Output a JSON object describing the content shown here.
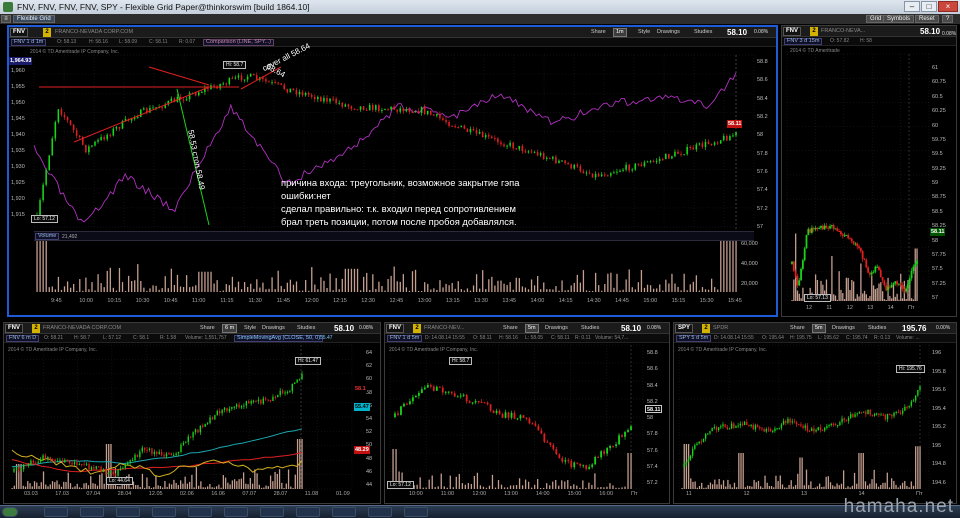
{
  "window": {
    "title": "FNV, FNV, FNV, FNV, SPY - Flexible Grid Paper@thinkorswim [build 1864.10]"
  },
  "menu": {
    "tab": "Flexible Grid",
    "grid": "Grid",
    "symbols": "Symbols",
    "reset": "Reset",
    "help": "?"
  },
  "common": {
    "company": "FRANCO-NEVADA CORP.COM",
    "share": "Share",
    "style": "Style",
    "drawings": "Drawings",
    "studies": "Studies",
    "badge": "2",
    "copyright": "2014 © TD Ameritrade IP Company, Inc."
  },
  "main": {
    "symbol": "FNV",
    "price": "58.10",
    "change": "0.08%",
    "info": {
      "chip": "FNV 1 d 1m",
      "o": "O: 58.13",
      "h": "H: 58.16",
      "l": "L: 58.09",
      "c": "C: 58.11",
      "r": "R: 0.07",
      "cmp": "Comparison (LINE, SPY...)"
    },
    "yticks": [
      "58.8",
      "58.6",
      "58.4",
      "58.2",
      "58",
      "57.8",
      "57.6",
      "57.4",
      "57.2",
      "57"
    ],
    "left_price": "1,964.93",
    "left_ticks": [
      "1,960",
      "1,955",
      "1,950",
      "1,945",
      "1,940",
      "1,935",
      "1,930",
      "1,925",
      "1,920",
      "1,915"
    ],
    "price_tag": "58.11",
    "hi": "Hi: 58.7",
    "lo": "Lo: 57.12",
    "vol_label": "Volume",
    "vol_value": "21,492",
    "vol_ticks": [
      "60,000",
      "40,000",
      "20,000"
    ],
    "xticks": [
      "9:45",
      "10:00",
      "10:15",
      "10:30",
      "10:45",
      "11:00",
      "11:15",
      "11:30",
      "11:45",
      "12:00",
      "12:15",
      "12:30",
      "12:45",
      "13:00",
      "13:15",
      "13:30",
      "13:45",
      "14:00",
      "14:15",
      "14:30",
      "14:45",
      "15:00",
      "15:15",
      "15:30",
      "15:45"
    ],
    "annotations": {
      "a1": "58.64",
      "a2": "cover all 58.64",
      "a3": "58.53 стоп 58.49"
    },
    "note": [
      "причина входа: треугольник, возможное закрытие гэпа",
      "ошибки:нет",
      "сделал правильно: т.к. входил перед сопротивлением",
      "брал треть позиции, потом после пробоя добавлялся."
    ]
  },
  "topright": {
    "symbol": "FNV",
    "price": "58.10",
    "change": "0.08%",
    "chip": "FNV 3 d 15m",
    "o": "O: 57.82",
    "h": "H: 58",
    "yticks": [
      "61",
      "60.75",
      "60.5",
      "60.25",
      "60",
      "59.75",
      "59.5",
      "59.25",
      "59",
      "58.75",
      "58.5",
      "58.25",
      "58",
      "57.75",
      "57.5",
      "57.25",
      "57"
    ],
    "price_tag": "58.11",
    "lo": "Lo: 57.13",
    "xticks": [
      "12",
      "11",
      "12",
      "13",
      "14",
      "Пт"
    ]
  },
  "bl": {
    "symbol": "FNV",
    "price": "58.10",
    "change": "0.08%",
    "info": {
      "chip": "FNV 6 m D",
      "o": "O: 58.21",
      "h": "H: 58.7",
      "l": "L: 57.12",
      "c": "C: 58.1",
      "r": "R: 1.58",
      "vol": "Volume: 1,551,757",
      "sma": "SimpleMovingAvg (CLOSE, 50, 0)",
      "sma_val": "55.47"
    },
    "yticks": [
      "64",
      "62",
      "60",
      "58",
      "56",
      "54",
      "52",
      "50",
      "48",
      "46",
      "44"
    ],
    "tags": {
      "price": "58.1",
      "sma": "55.47",
      "other": "48.29"
    },
    "hi": "Hi: 61.47",
    "lo": "Lo: 44.64",
    "xticks": [
      "03.03",
      "17.03",
      "07.04",
      "28.04",
      "12.05",
      "02.06",
      "16.06",
      "07.07",
      "28.07",
      "11.08",
      "01.09"
    ]
  },
  "bm": {
    "symbol": "FNV",
    "price": "58.10",
    "change": "0.08%",
    "info": {
      "chip": "FNV 1 d 5m",
      "d": "D: 14.08.14 15:55",
      "o": "O: 58.11",
      "h": "H: 58.16",
      "l": "L: 58.05",
      "c": "C: 58.11",
      "r": "R: 0.11",
      "vol": "Volume: 54,7..."
    },
    "yticks": [
      "58.8",
      "58.6",
      "58.4",
      "58.2",
      "58",
      "57.8",
      "57.6",
      "57.4",
      "57.2"
    ],
    "price_tag": "58.11",
    "hi": "Hi: 58.7",
    "lo": "Lo: 57.12",
    "xticks": [
      "10:00",
      "11:00",
      "12:00",
      "13:00",
      "14:00",
      "15:00",
      "16:00",
      "Пт"
    ]
  },
  "br": {
    "symbol": "SPY",
    "price": "195.76",
    "change": "0.00%",
    "info": {
      "chip": "SPY 5 d 5m",
      "d": "D: 14.08.14 15:55",
      "o": "O: 195.64",
      "h": "H: 195.75",
      "l": "L: 195.62",
      "c": "C: 195.74",
      "r": "R: 0.13",
      "vol": "Volume: ..."
    },
    "name": "SPDR",
    "yticks": [
      "196",
      "195.8",
      "195.6",
      "195.4",
      "195.2",
      "195",
      "194.8",
      "194.6"
    ],
    "hi": "Hi: 195.76",
    "xticks": [
      "11",
      "12",
      "13",
      "14",
      "Пт"
    ]
  },
  "watermark": "hamaha.net"
}
